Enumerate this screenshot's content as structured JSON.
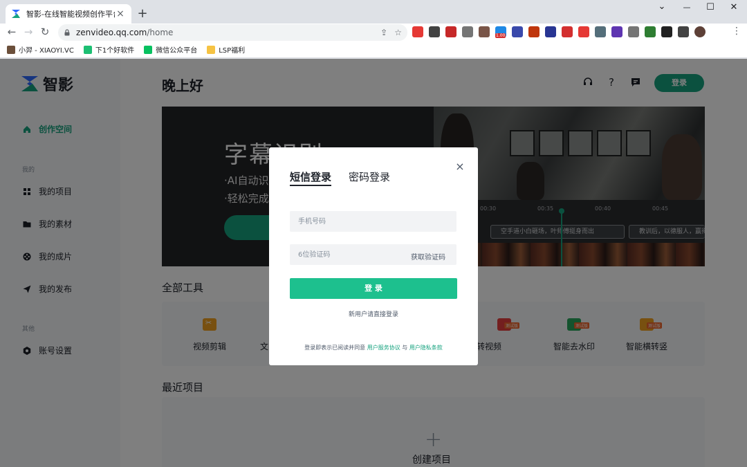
{
  "browser": {
    "tab_title": "智影-在线智能视频创作平台",
    "tab_close": "×",
    "new_tab": "+",
    "window_controls": {
      "chevron": "⌄",
      "minimize": "—",
      "maximize": "☐",
      "close": "✕"
    },
    "nav": {
      "back": "←",
      "forward": "→",
      "reload": "↻"
    },
    "url_host": "zenvideo.qq.com",
    "url_path": "/home",
    "menu": "⋮",
    "bookmarks": [
      {
        "label": "小羿 - XIAOYI.VC",
        "color": "#6b4f3a"
      },
      {
        "label": "下1个好软件",
        "color": "#1dbf73"
      },
      {
        "label": "微信公众平台",
        "color": "#07c160"
      },
      {
        "label": "LSP福利",
        "color": "#f6c343"
      }
    ],
    "extension_colors": [
      "#e53935",
      "#424242",
      "#c62828",
      "#757575",
      "#795548",
      "#1e88e5",
      "#3949ab",
      "#bf360c",
      "#283593",
      "#d32f2f",
      "#e53935",
      "#546e7a",
      "#5e35b1",
      "#757575",
      "#2e7d32",
      "#212121",
      "#424242",
      "#5d4037"
    ],
    "extension_badge": "1.00"
  },
  "app": {
    "logo_text": "智影",
    "accent": "#16a37f",
    "sidebar": {
      "active_item": "创作空间",
      "group_mine": "我的",
      "items_mine": [
        "我的项目",
        "我的素材",
        "我的成片",
        "我的发布"
      ],
      "group_other": "其他",
      "items_other": [
        "账号设置"
      ]
    },
    "header": {
      "greeting": "晚上好",
      "login": "登录"
    },
    "banner": {
      "title": "字幕识别",
      "line1": "·AI自动识",
      "line2": "·轻松完成",
      "timeline_ticks": [
        "00:30",
        "00:35",
        "00:40",
        "00:45"
      ],
      "caption1": "空手道小白砸场，叶师傅挺身而出",
      "caption2": "教训后，以德服人，赢得"
    },
    "tools_title": "全部工具",
    "tools": [
      {
        "label": "视频剪辑",
        "color": "#f0a020"
      },
      {
        "label": "文",
        "color": "#f7f8fa"
      },
      {
        "label": "文章转视频",
        "color": "#e63e3e",
        "badge": "测试版"
      },
      {
        "label": "智能去水印",
        "color": "#29a65d",
        "badge": "测试版"
      },
      {
        "label": "智能横转竖",
        "color": "#f0a020",
        "badge": "测试版"
      }
    ],
    "recent_title": "最近项目",
    "create_project": "创建项目",
    "plus": "+"
  },
  "modal": {
    "tab_sms": "短信登录",
    "tab_password": "密码登录",
    "close": "×",
    "phone_placeholder": "手机号码",
    "code_placeholder": "6位验证码",
    "get_code": "获取验证码",
    "login": "登 录",
    "new_user_hint": "新用户请直接登录",
    "terms_prefix": "登录即表示已阅读并同意",
    "terms_link1": "用户服务协议",
    "terms_and": "与",
    "terms_link2": "用户隐私条款",
    "button_color": "#1dc08e"
  }
}
